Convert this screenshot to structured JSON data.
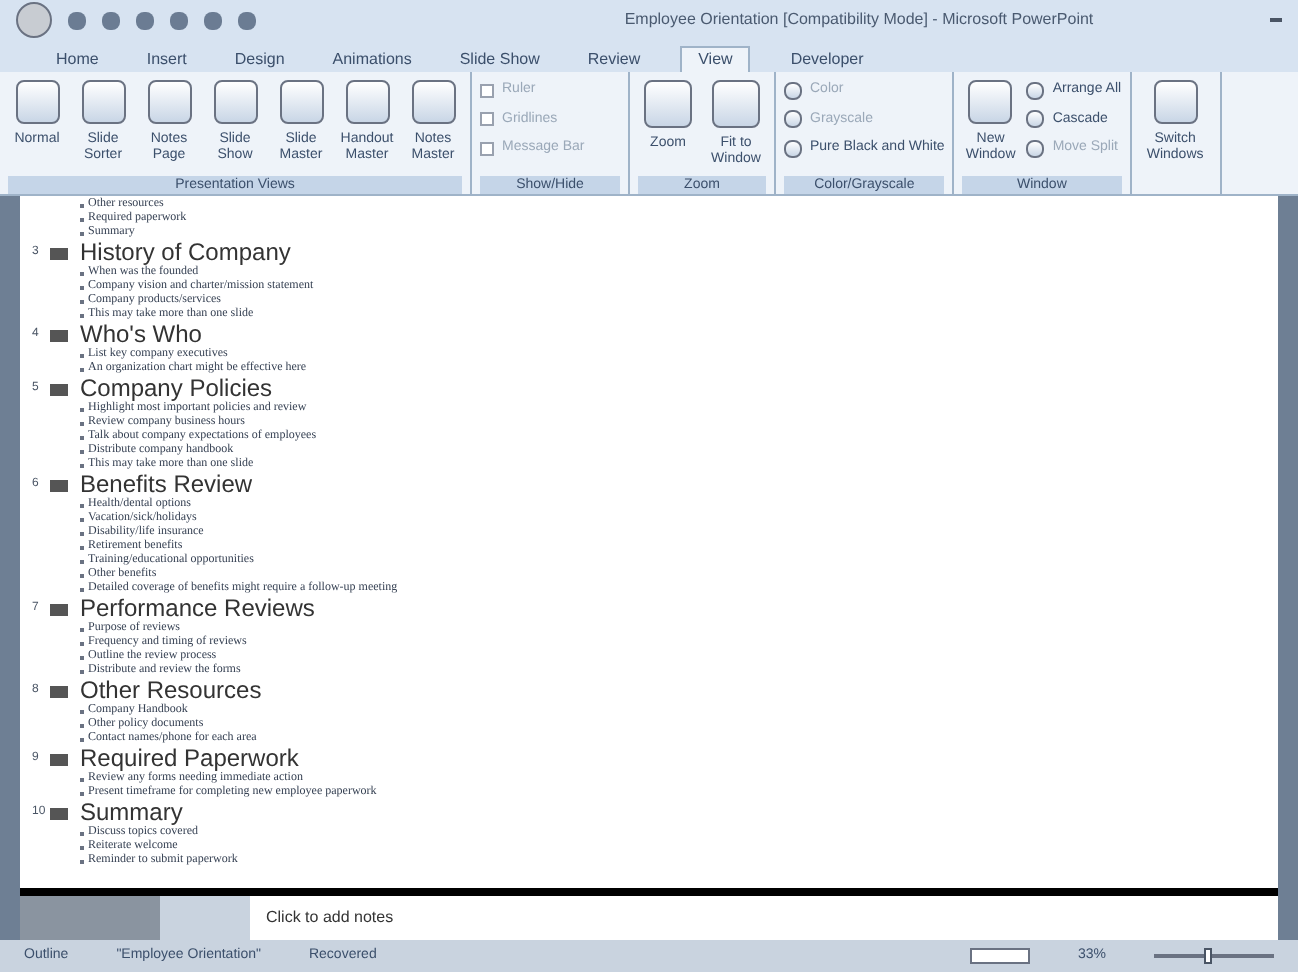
{
  "window": {
    "title": "Employee Orientation [Compatibility Mode] - Microsoft PowerPoint"
  },
  "tabs": [
    {
      "label": "Home",
      "selected": false
    },
    {
      "label": "Insert",
      "selected": false
    },
    {
      "label": "Design",
      "selected": false
    },
    {
      "label": "Animations",
      "selected": false
    },
    {
      "label": "Slide Show",
      "selected": false
    },
    {
      "label": "Review",
      "selected": false
    },
    {
      "label": "View",
      "selected": true
    },
    {
      "label": "Developer",
      "selected": false
    }
  ],
  "ribbon": {
    "presentation_views": {
      "label": "Presentation Views",
      "buttons": [
        "Normal",
        "Slide Sorter",
        "Notes Page",
        "Slide Show",
        "Slide Master",
        "Handout Master",
        "Notes Master"
      ]
    },
    "show_hide": {
      "label": "Show/Hide",
      "options": [
        {
          "label": "Ruler",
          "checked": false
        },
        {
          "label": "Gridlines",
          "checked": false
        },
        {
          "label": "Message Bar",
          "checked": false
        }
      ]
    },
    "zoom": {
      "label": "Zoom",
      "buttons": [
        "Zoom",
        "Fit to Window"
      ]
    },
    "color": {
      "label": "Color/Grayscale",
      "options": [
        "Color",
        "Grayscale",
        "Pure Black and White"
      ]
    },
    "window": {
      "label": "Window",
      "new_window": "New Window",
      "options": [
        "Arrange All",
        "Cascade",
        "Move Split"
      ],
      "switch": "Switch Windows"
    }
  },
  "outline": {
    "leading": [
      "Other resources",
      "Required paperwork",
      "Summary"
    ],
    "slides": [
      {
        "number": "3",
        "title": "History of Company",
        "bullets": [
          "When was the founded",
          "Company vision and charter/mission statement",
          "Company products/services",
          "This may take more than one slide"
        ]
      },
      {
        "number": "4",
        "title": "Who's Who",
        "bullets": [
          "List key company executives",
          "An organization chart might be effective here"
        ]
      },
      {
        "number": "5",
        "title": "Company Policies",
        "bullets": [
          "Highlight most important policies and review",
          "Review company business hours",
          "Talk about company expectations of employees",
          "Distribute company handbook",
          "This may take more than one slide"
        ]
      },
      {
        "number": "6",
        "title": "Benefits Review",
        "bullets": [
          "Health/dental options",
          "Vacation/sick/holidays",
          "Disability/life insurance",
          "Retirement benefits",
          "Training/educational opportunities",
          "Other benefits",
          "Detailed coverage of benefits might require a follow-up meeting"
        ]
      },
      {
        "number": "7",
        "title": "Performance Reviews",
        "bullets": [
          "Purpose of reviews",
          "Frequency and timing of reviews",
          "Outline the review process",
          "Distribute and review the forms"
        ]
      },
      {
        "number": "8",
        "title": "Other Resources",
        "bullets": [
          "Company Handbook",
          "Other policy documents",
          "Contact names/phone for each area"
        ]
      },
      {
        "number": "9",
        "title": "Required Paperwork",
        "bullets": [
          "Review any forms needing immediate action",
          "Present timeframe for completing new employee paperwork"
        ]
      },
      {
        "number": "10",
        "title": "Summary",
        "bullets": [
          "Discuss topics covered",
          "Reiterate welcome",
          "Reminder to submit paperwork"
        ]
      }
    ]
  },
  "notes": {
    "placeholder": "Click to add notes"
  },
  "status_bar": {
    "items": [
      "Outline",
      "\"Employee Orientation\"",
      "Recovered"
    ],
    "zoom": "33%",
    "zoom_slider": {
      "level": 0.45
    }
  }
}
